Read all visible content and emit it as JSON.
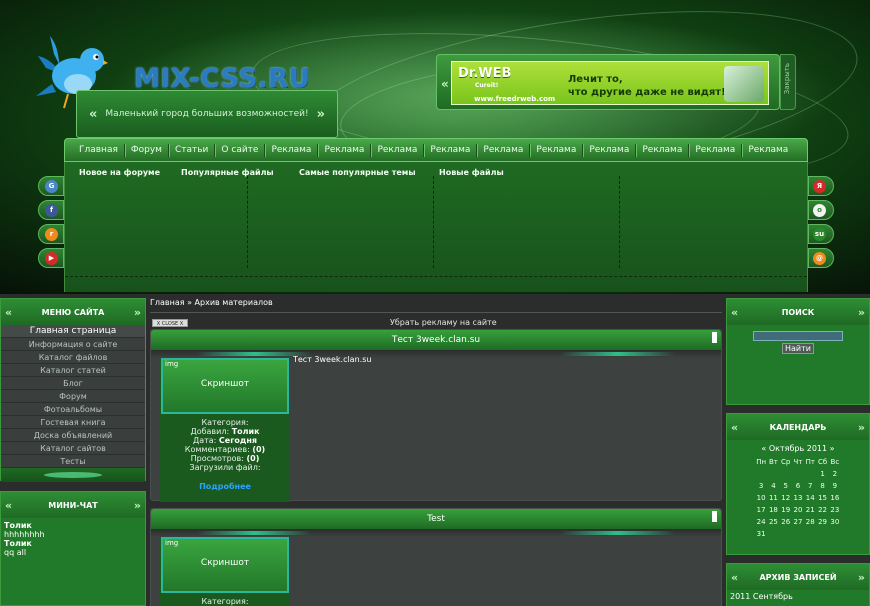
{
  "header": {
    "logo": "MIX-CSS.RU",
    "slogan": "Маленький город больших возможностей!"
  },
  "ad": {
    "brand": "Dr.WEB",
    "brand_sub": "Cureit!",
    "url": "www.freedrweb.com",
    "line1": "Лечит то,",
    "line2": "что другие даже не видят!",
    "close_label": "Закрыть"
  },
  "nav": [
    {
      "label": "Главная"
    },
    {
      "label": "Форум"
    },
    {
      "label": "Статьи"
    },
    {
      "label": "О сайте"
    },
    {
      "label": "Реклама"
    },
    {
      "label": "Реклама"
    },
    {
      "label": "Реклама"
    },
    {
      "label": "Реклама"
    },
    {
      "label": "Реклама"
    },
    {
      "label": "Реклама"
    },
    {
      "label": "Реклама"
    },
    {
      "label": "Реклама"
    },
    {
      "label": "Реклама"
    },
    {
      "label": "Реклама"
    }
  ],
  "blocks": {
    "forum": "Новое на форуме",
    "files": "Популярные файлы",
    "topics": "Самые популярные темы",
    "newfiles": "Новые файлы"
  },
  "breadcrumb": "Главная » Архив материалов",
  "close_ad_label": "X CLOSE X",
  "remove_ad": "Убрать рекламу на сайте",
  "menu": {
    "title": "МЕНЮ САЙТА",
    "items": [
      "Главная страница",
      "Информация о сайте",
      "Каталог файлов",
      "Каталог статей",
      "Блог",
      "Форум",
      "Фотоальбомы",
      "Гостевая книга",
      "Доска объявлений",
      "Каталог сайтов",
      "Тесты"
    ]
  },
  "chat": {
    "title": "МИНИ-ЧАТ",
    "lines": [
      "Толик",
      "hhhhhhhh",
      "Толик",
      "qq all"
    ]
  },
  "posts": [
    {
      "title": "Тест 3week.clan.su",
      "img_tag": "img",
      "img_caption": "Скриншот",
      "category_label": "Категория:",
      "added_label": "Добавил:",
      "added_by": "Толик",
      "date_label": "Дата:",
      "date": "Сегодня",
      "comments_label": "Комментариев:",
      "comments": "(0)",
      "views_label": "Просмотров:",
      "views": "(0)",
      "uploaded_label": "Загрузили файл:",
      "more": "Подробнее",
      "text": "Тест 3week.clan.su"
    },
    {
      "title": "Test",
      "img_tag": "img",
      "img_caption": "Скриншот",
      "category_label": "Категория:"
    }
  ],
  "search": {
    "title": "ПОИСК",
    "button": "Найти"
  },
  "calendar": {
    "title": "КАЛЕНДАРЬ",
    "prev": "«",
    "month": "Октябрь 2011",
    "next": "»",
    "weekdays": [
      "Пн",
      "Вт",
      "Ср",
      "Чт",
      "Пт",
      "Сб",
      "Вс"
    ],
    "weeks": [
      [
        "",
        "",
        "",
        "",
        "",
        "1",
        "2"
      ],
      [
        "3",
        "4",
        "5",
        "6",
        "7",
        "8",
        "9"
      ],
      [
        "10",
        "11",
        "12",
        "13",
        "14",
        "15",
        "16"
      ],
      [
        "17",
        "18",
        "19",
        "20",
        "21",
        "22",
        "23"
      ],
      [
        "24",
        "25",
        "26",
        "27",
        "28",
        "29",
        "30"
      ],
      [
        "31",
        "",
        "",
        "",
        "",
        "",
        ""
      ]
    ]
  },
  "archive": {
    "title": "АРХИВ ЗАПИСЕЙ",
    "items": [
      "2011 Сентябрь"
    ]
  },
  "colors": {
    "accent_green": "#217a29",
    "link_blue": "#2aa3ff",
    "logo_blue": "#2a7bbf"
  },
  "icons": {
    "social_left": [
      "google-icon",
      "facebook-icon",
      "rss-icon",
      "youtube-icon"
    ],
    "social_right": [
      "yandex-icon",
      "odnoklassniki-icon",
      "stumbleupon-icon",
      "mail-icon"
    ]
  }
}
